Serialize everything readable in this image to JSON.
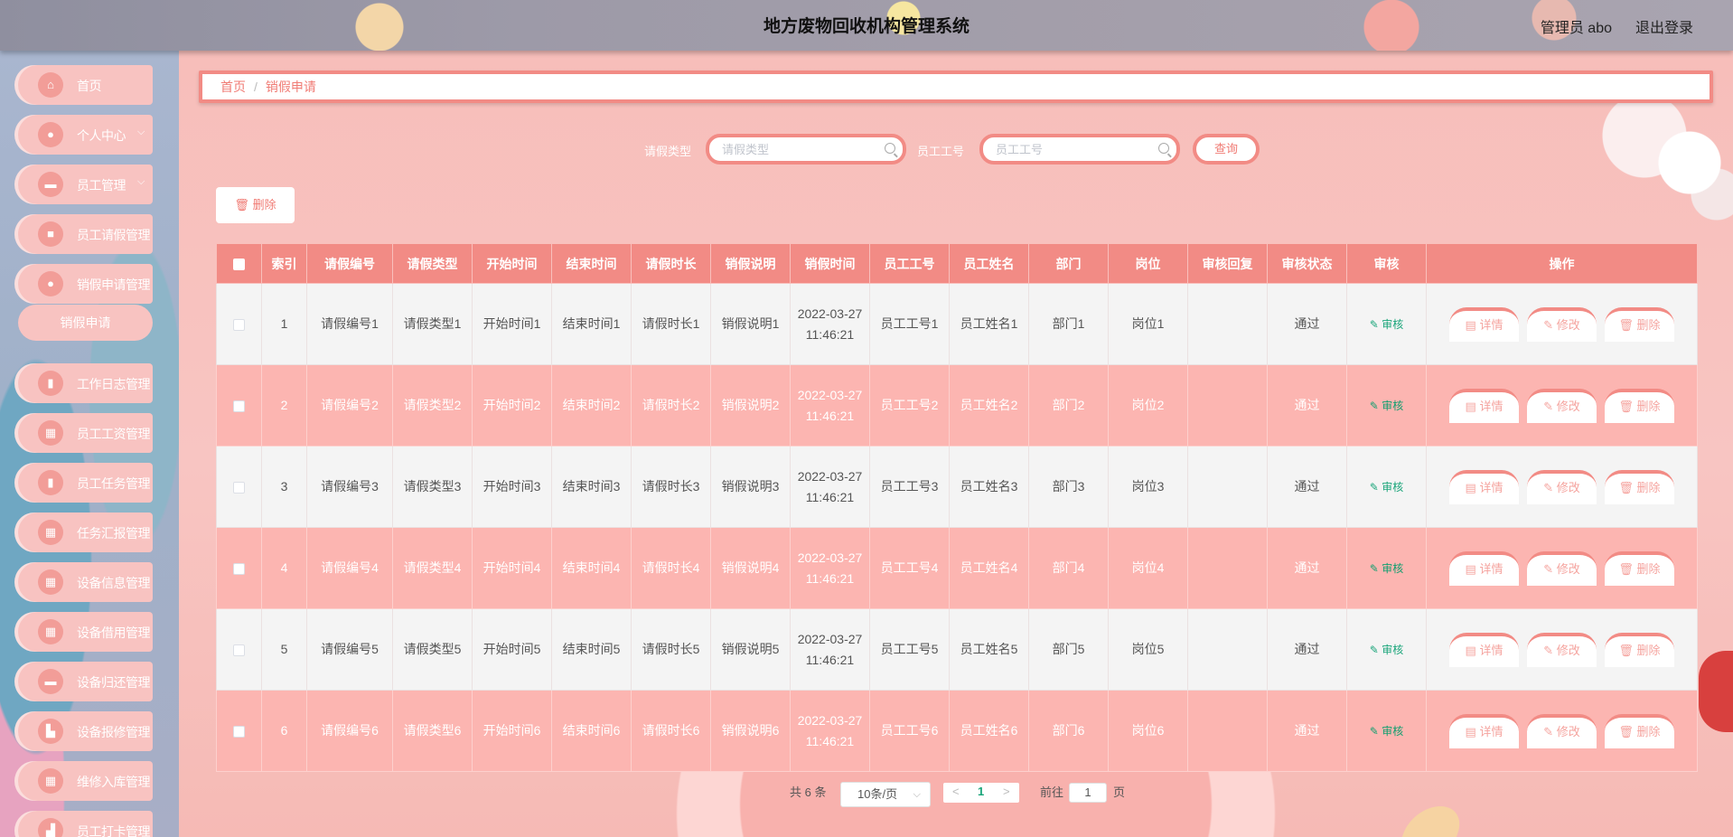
{
  "app": {
    "title": "地方废物回收机构管理系统",
    "user": "管理员 abo",
    "logout": "退出登录"
  },
  "sidebar": {
    "items": [
      {
        "label": "首页",
        "icon": "home-icon",
        "glyph": "⌂"
      },
      {
        "label": "个人中心",
        "icon": "user-icon",
        "glyph": "●",
        "chevron": "⌵"
      },
      {
        "label": "员工管理",
        "icon": "employee-icon",
        "glyph": "▬",
        "chevron": "⌵"
      },
      {
        "label": "员工请假管理",
        "icon": "briefcase-icon",
        "glyph": "■"
      },
      {
        "label": "销假申请管理",
        "icon": "location-icon",
        "glyph": "●"
      },
      {
        "label": "工作日志管理",
        "icon": "clipboard-icon",
        "glyph": "▮"
      },
      {
        "label": "员工工资管理",
        "icon": "grid-icon",
        "glyph": "▦"
      },
      {
        "label": "员工任务管理",
        "icon": "clipboard-icon",
        "glyph": "▮"
      },
      {
        "label": "任务汇报管理",
        "icon": "grid-icon",
        "glyph": "▦"
      },
      {
        "label": "设备信息管理",
        "icon": "grid-icon",
        "glyph": "▦"
      },
      {
        "label": "设备借用管理",
        "icon": "grid-icon",
        "glyph": "▦"
      },
      {
        "label": "设备归还管理",
        "icon": "chat-icon",
        "glyph": "▬"
      },
      {
        "label": "设备报修管理",
        "icon": "building-icon",
        "glyph": "▙"
      },
      {
        "label": "维修入库管理",
        "icon": "grid-icon",
        "glyph": "▦"
      },
      {
        "label": "员工打卡管理",
        "icon": "chart-icon",
        "glyph": "▟"
      }
    ],
    "sub_item": "销假申请"
  },
  "breadcrumb": {
    "home": "首页",
    "separator": "/",
    "current": "销假申请"
  },
  "search": {
    "leave_type_label": "请假类型",
    "leave_type_placeholder": "请假类型",
    "emp_no_label": "员工工号",
    "emp_no_placeholder": "员工工号",
    "query_button": "查询"
  },
  "toolbar": {
    "delete_label": "删除",
    "delete_icon": "trash-icon"
  },
  "table": {
    "headers": [
      "索引",
      "请假编号",
      "请假类型",
      "开始时间",
      "结束时间",
      "请假时长",
      "销假说明",
      "销假时间",
      "员工工号",
      "员工姓名",
      "部门",
      "岗位",
      "审核回复",
      "审核状态",
      "审核",
      "操作"
    ],
    "rows": [
      [
        "1",
        "请假编号1",
        "请假类型1",
        "开始时间1",
        "结束时间1",
        "请假时长1",
        "销假说明1",
        "2022-03-27 11:46:21",
        "员工工号1",
        "员工姓名1",
        "部门1",
        "岗位1",
        "",
        "通过"
      ],
      [
        "2",
        "请假编号2",
        "请假类型2",
        "开始时间2",
        "结束时间2",
        "请假时长2",
        "销假说明2",
        "2022-03-27 11:46:21",
        "员工工号2",
        "员工姓名2",
        "部门2",
        "岗位2",
        "",
        "通过"
      ],
      [
        "3",
        "请假编号3",
        "请假类型3",
        "开始时间3",
        "结束时间3",
        "请假时长3",
        "销假说明3",
        "2022-03-27 11:46:21",
        "员工工号3",
        "员工姓名3",
        "部门3",
        "岗位3",
        "",
        "通过"
      ],
      [
        "4",
        "请假编号4",
        "请假类型4",
        "开始时间4",
        "结束时间4",
        "请假时长4",
        "销假说明4",
        "2022-03-27 11:46:21",
        "员工工号4",
        "员工姓名4",
        "部门4",
        "岗位4",
        "",
        "通过"
      ],
      [
        "5",
        "请假编号5",
        "请假类型5",
        "开始时间5",
        "结束时间5",
        "请假时长5",
        "销假说明5",
        "2022-03-27 11:46:21",
        "员工工号5",
        "员工姓名5",
        "部门5",
        "岗位5",
        "",
        "通过"
      ],
      [
        "6",
        "请假编号6",
        "请假类型6",
        "开始时间6",
        "结束时间6",
        "请假时长6",
        "销假说明6",
        "2022-03-27 11:46:21",
        "员工工号6",
        "员工姓名6",
        "部门6",
        "岗位6",
        "",
        "通过"
      ]
    ],
    "audit_link": "审核",
    "actions": {
      "detail": "详情",
      "edit": "修改",
      "delete": "删除"
    }
  },
  "pagination": {
    "total": "共 6 条",
    "page_size": "10条/页",
    "prev": "<",
    "current_page": "1",
    "next": ">",
    "goto_prefix": "前往",
    "goto_value": "1",
    "goto_suffix": "页"
  },
  "colors": {
    "accent": "#f28b85",
    "row_alt": "#fcb5b1",
    "audit_green": "#1aa57a"
  }
}
